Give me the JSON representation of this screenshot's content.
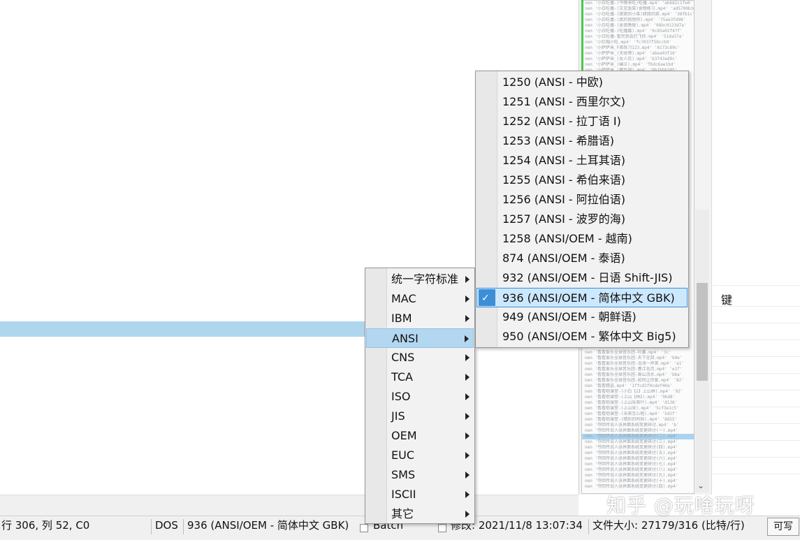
{
  "minimap": {
    "lines": [
      "nen '小白吃播-(今晚来吃)吃播.mp4' 'ab6d2c1fe0'",
      "nen '小白吃播-(又见饭菜)食物练习.mp4' 'ad5709b3d3'",
      "nen '小白吃播-(姥姥的小菜)姥姥的菜.mp4' '38fb1c'",
      "nen '小白吃播-(真的很想你).mp4' '75ae3fd98'",
      "nen '小白吃播-(夏夜晚餐).mp4' '08bc0123d7a'",
      "nen '小白吃播-(吃播篇).mp4' '0c85a02f47f'",
      "nen '小白吃播-看完我会打飞你.mp4' '51da37a'",
      "nen '小红帽小吃.mp4' 'fc7037f58ccb9'",
      "nen '小萨萨米_F首练习123.mp4' '8173c89c'",
      "nen '小萨萨米_(天体博).mp4' 'abea03f16'",
      "nen '小萨萨米_(女人花).mp4' 'b3743ad9c'",
      "nen '小萨萨米_(幽兰).mp4' 'fbdc6ae1bd'",
      "nen '小萨萨米_(紫竹调).mp4' '6b1bbb205'"
    ],
    "lines_bottom": [
      "nen '看看爱乐全球音乐团-吐蕃.mp4' '3c'",
      "nen '看看爱乐全球音乐团-天下无双.mp4' 'b9e'",
      "nen '看看爱乐全球音乐团-沧海一声笑.mp4' 'a1'",
      "nen '看看爱乐全球音乐团-春江花月.mp4' 'e1f'",
      "nen '看看爱乐全球音乐团-高山流水.mp4' 'bba'",
      "nen '看看爱乐全球音乐团-如何让你爱.mp4' '82'",
      "nen '看看精选.mp4' '1ffcd1f0cdef40a'",
      "nen '看看唱课堂-(小白【2】上山林).mp4' '92'",
      "nen '看看唱课堂-(上山【林】).mp4' '9bd8'",
      "nen '看看唱课堂-(上山采茶叶).mp4' 'd138'",
      "nen '看看唱课堂-(上山采).mp4' '5cf3e1c5'",
      "nen '看看唱课堂-(采茶怎么唱).mp4' '5d2f'",
      "nen '看看唱课堂-(精彩的时刻).mp4' '8d25'",
      "nen '夺回传说人张界面系统变更研讨.mp4' 'b'",
      "nen '夺回传说人张界面系统变更研讨(一).mp4'",
      "nen '夺回传说人张界面系统变更研讨(二).mp4'",
      "nen '夺回传说人张界面系统变更研讨(三).mp4'",
      "nen '夺回传说人张界面系统变更研讨(四).mp4'",
      "nen '夺回传说人张界面系统变更研讨(五).mp4'",
      "nen '夺回传说人张界面系统变更研讨(六).mp4'",
      "nen '夺回传说人张界面系统变更研讨(七).mp4'",
      "nen '夺回传说人张界面系统变更研讨(八).mp4'",
      "nen '夺回传说人张界面系统变更研讨(九).mp4'",
      "nen '夺回传说人张界面系统变更研讨(十).mp4'",
      "nen '夺回传说人张界面系统变更研讨(四).mp4'"
    ],
    "highlight_index": 15
  },
  "right_panel": {
    "key_label": "键"
  },
  "menu1": {
    "items": [
      {
        "label": "统一字符标准"
      },
      {
        "label": "MAC"
      },
      {
        "label": "IBM"
      },
      {
        "label": "ANSI"
      },
      {
        "label": "CNS"
      },
      {
        "label": "TCA"
      },
      {
        "label": "ISO"
      },
      {
        "label": "JIS"
      },
      {
        "label": "OEM"
      },
      {
        "label": "EUC"
      },
      {
        "label": "SMS"
      },
      {
        "label": "ISCII"
      },
      {
        "label": "其它"
      }
    ],
    "selected_index": 3
  },
  "menu2": {
    "items": [
      {
        "label": "1250  (ANSI - 中欧)"
      },
      {
        "label": "1251  (ANSI - 西里尔文)"
      },
      {
        "label": "1252  (ANSI - 拉丁语 I)"
      },
      {
        "label": "1253  (ANSI - 希腊语)"
      },
      {
        "label": "1254  (ANSI - 土耳其语)"
      },
      {
        "label": "1255  (ANSI - 希伯来语)"
      },
      {
        "label": "1256  (ANSI - 阿拉伯语)"
      },
      {
        "label": "1257  (ANSI - 波罗的海)"
      },
      {
        "label": "1258  (ANSI/OEM - 越南)"
      },
      {
        "label": "874  (ANSI/OEM - 泰语)"
      },
      {
        "label": "932  (ANSI/OEM - 日语 Shift-JIS)"
      },
      {
        "label": "936  (ANSI/OEM - 简体中文 GBK)"
      },
      {
        "label": "949  (ANSI/OEM - 朝鲜语)"
      },
      {
        "label": "950  (ANSI/OEM - 繁体中文 Big5)"
      }
    ],
    "checked_index": 11,
    "check_glyph": "✓"
  },
  "statusbar": {
    "position": "行 306, 列 52, C0",
    "line_ending": "DOS",
    "encoding": "936  (ANSI/OEM - 简体中文 GBK)",
    "syntax": "Batch",
    "modified": "修改:   2021/11/8 13:07:34",
    "filesize": "文件大小:   27179/316   (比特/行)",
    "mode": "可写"
  },
  "watermark": "知乎 @玩啥玩呀"
}
